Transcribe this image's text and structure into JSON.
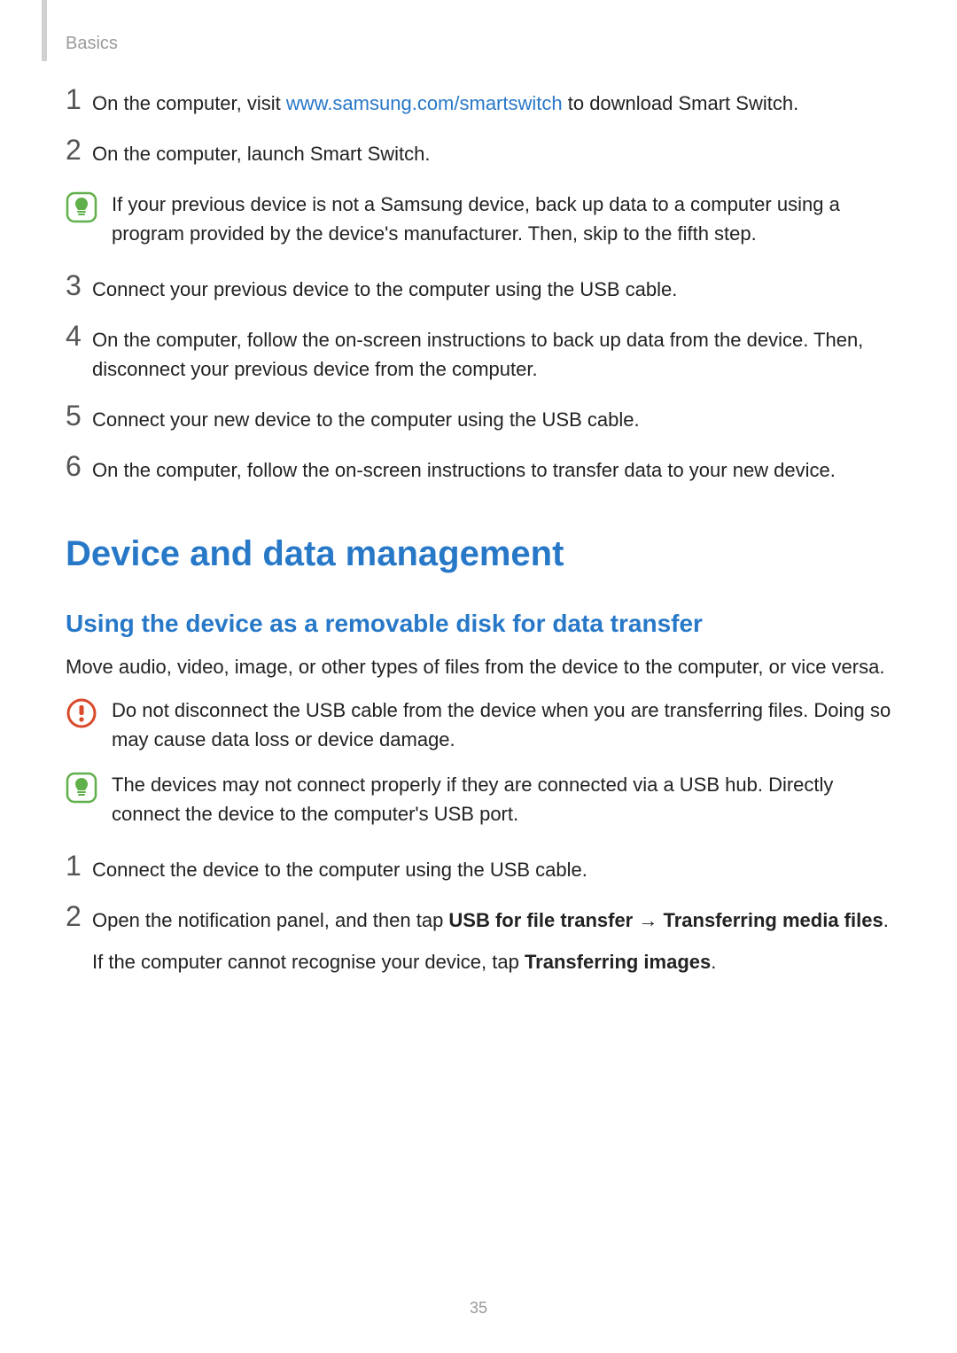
{
  "breadcrumb": "Basics",
  "stepsA": {
    "s1": {
      "num": "1",
      "pre": "On the computer, visit ",
      "link": "www.samsung.com/smartswitch",
      "post": " to download Smart Switch."
    },
    "s2": {
      "num": "2",
      "text": "On the computer, launch Smart Switch."
    },
    "note1": "If your previous device is not a Samsung device, back up data to a computer using a program provided by the device's manufacturer. Then, skip to the fifth step.",
    "s3": {
      "num": "3",
      "text": "Connect your previous device to the computer using the USB cable."
    },
    "s4": {
      "num": "4",
      "text": "On the computer, follow the on-screen instructions to back up data from the device. Then, disconnect your previous device from the computer."
    },
    "s5": {
      "num": "5",
      "text": "Connect your new device to the computer using the USB cable."
    },
    "s6": {
      "num": "6",
      "text": "On the computer, follow the on-screen instructions to transfer data to your new device."
    }
  },
  "h1": "Device and data management",
  "h2": "Using the device as a removable disk for data transfer",
  "para1": "Move audio, video, image, or other types of files from the device to the computer, or vice versa.",
  "warning1": "Do not disconnect the USB cable from the device when you are transferring files. Doing so may cause data loss or device damage.",
  "note2": "The devices may not connect properly if they are connected via a USB hub. Directly connect the device to the computer's USB port.",
  "stepsB": {
    "s1": {
      "num": "1",
      "text": "Connect the device to the computer using the USB cable."
    },
    "s2": {
      "num": "2",
      "pre": "Open the notification panel, and then tap ",
      "b1": "USB for file transfer",
      "arrow": " → ",
      "b2": "Transferring media files",
      "post": ".",
      "sub_pre": "If the computer cannot recognise your device, tap ",
      "sub_b": "Transferring images",
      "sub_post": "."
    }
  },
  "pageNum": "35"
}
